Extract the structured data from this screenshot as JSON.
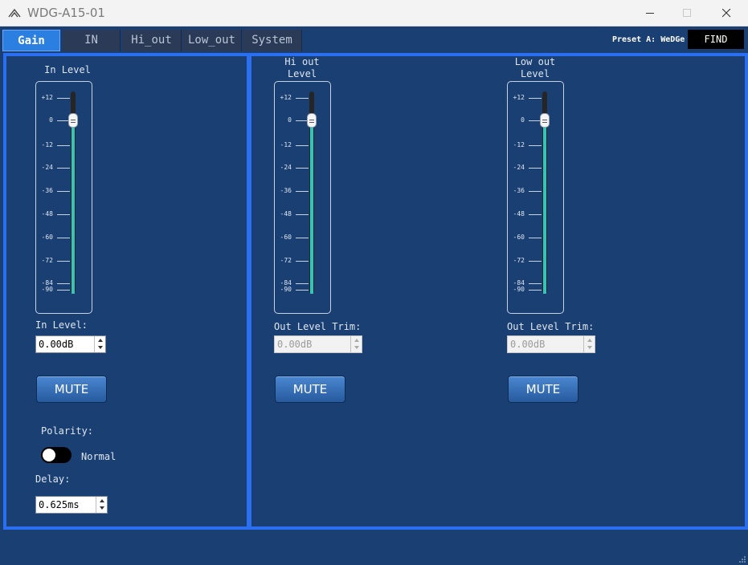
{
  "window": {
    "title": "WDG-A15-01"
  },
  "tabs": [
    {
      "label": "Gain",
      "active": true
    },
    {
      "label": "IN",
      "active": false
    },
    {
      "label": "Hi_out",
      "active": false
    },
    {
      "label": "Low_out",
      "active": false
    },
    {
      "label": "System",
      "active": false
    }
  ],
  "header": {
    "preset_label": "Preset A: WeDGe",
    "find_label": "FIND"
  },
  "meter_scale": [
    "+12",
    "0",
    "-12",
    "-24",
    "-36",
    "-48",
    "-60",
    "-72",
    "-84",
    "-90"
  ],
  "input_panel": {
    "meter_title": "In Level",
    "meter_level_db": 0,
    "level_label": "In Level:",
    "level_value": "0.00dB",
    "mute_label": "MUTE",
    "polarity_label": "Polarity:",
    "polarity_state": "Normal",
    "delay_label": "Delay:",
    "delay_value": "0.625ms"
  },
  "hi_out_panel": {
    "meter_title_line1": "Hi out",
    "meter_title_line2": "Level",
    "meter_level_db": 0,
    "trim_label": "Out Level Trim:",
    "trim_value": "0.00dB",
    "mute_label": "MUTE"
  },
  "low_out_panel": {
    "meter_title_line1": "Low out",
    "meter_title_line2": "Level",
    "meter_level_db": 0,
    "trim_label": "Out Level Trim:",
    "trim_value": "0.00dB",
    "mute_label": "MUTE"
  },
  "colors": {
    "background": "#1a3f73",
    "panel_border": "#2a6ff2",
    "meter_fill": "#39c3b6",
    "active_tab": "#2a7fe0"
  },
  "icons": {
    "app_logo": "app-logo-icon",
    "minimize": "minimize-icon",
    "maximize": "maximize-icon",
    "close": "close-icon"
  }
}
